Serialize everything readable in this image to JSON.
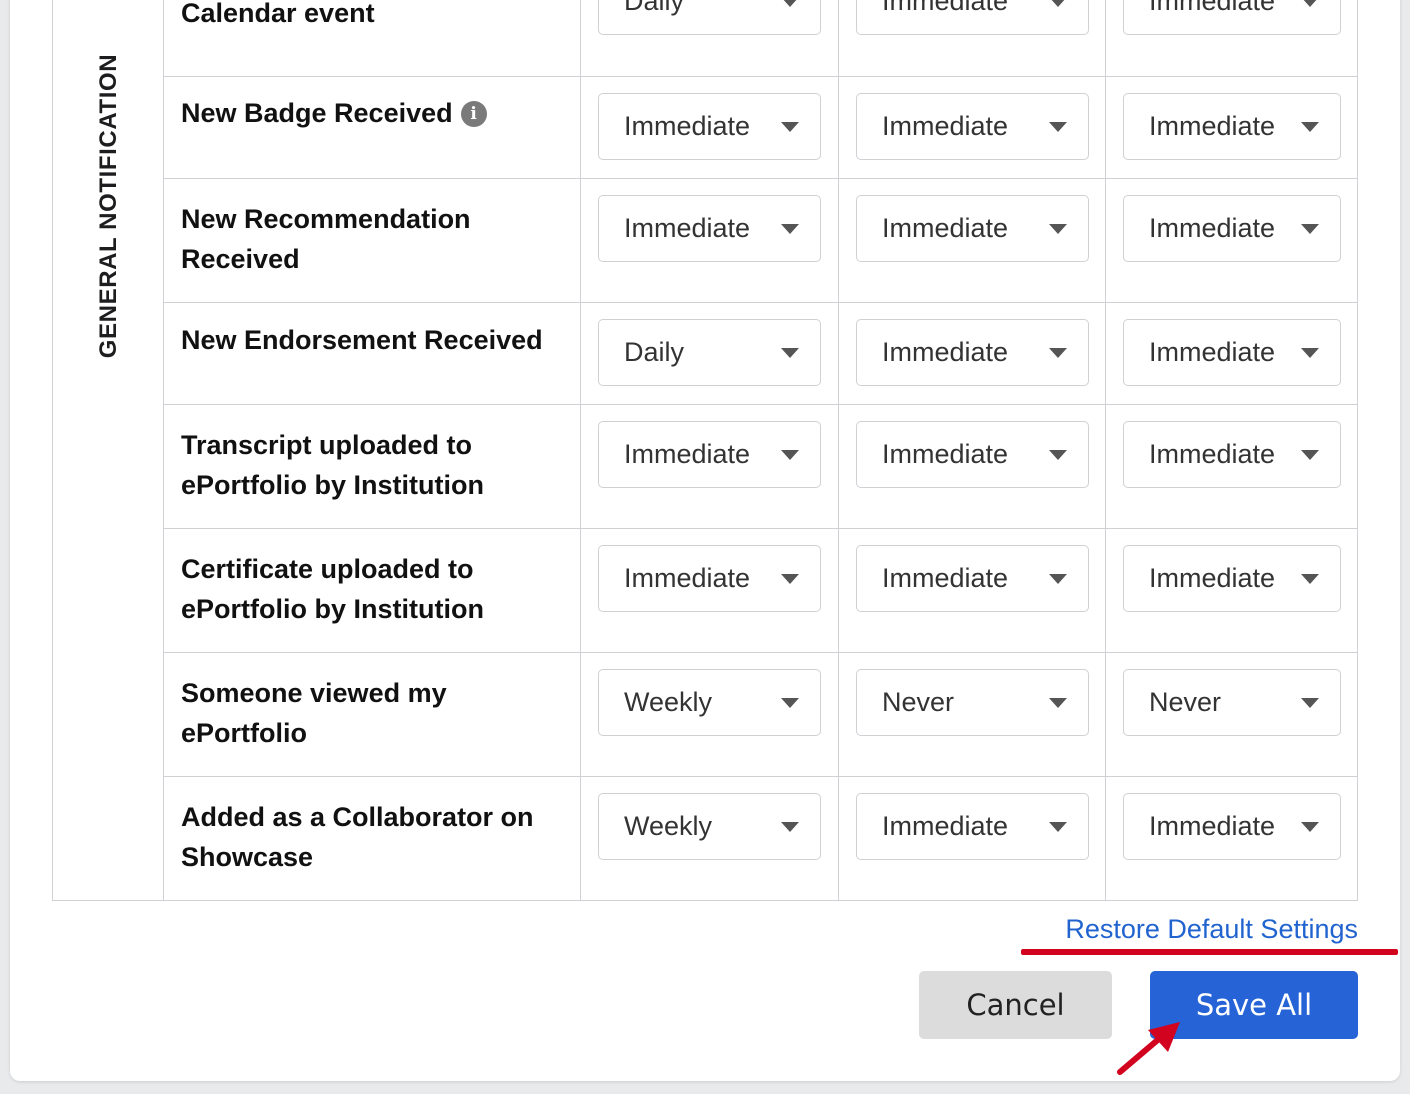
{
  "section": {
    "title": "GENERAL NOTIFICATION"
  },
  "rows": [
    {
      "name": "Calendar event",
      "v1": "Daily",
      "v2": "Immediate",
      "v3": "Immediate"
    },
    {
      "name": "New Badge Received",
      "v1": "Immediate",
      "v2": "Immediate",
      "v3": "Immediate"
    },
    {
      "name": "New Recommendation Received",
      "v1": "Immediate",
      "v2": "Immediate",
      "v3": "Immediate"
    },
    {
      "name": "New Endorsement Received",
      "v1": "Daily",
      "v2": "Immediate",
      "v3": "Immediate"
    },
    {
      "name": "Transcript uploaded to ePortfolio by Institution",
      "v1": "Immediate",
      "v2": "Immediate",
      "v3": "Immediate"
    },
    {
      "name": "Certificate uploaded to ePortfolio by Institution",
      "v1": "Immediate",
      "v2": "Immediate",
      "v3": "Immediate"
    },
    {
      "name": "Someone viewed my ePortfolio",
      "v1": "Weekly",
      "v2": "Never",
      "v3": "Never"
    },
    {
      "name": "Added as a Collaborator on Showcase",
      "v1": "Weekly",
      "v2": "Immediate",
      "v3": "Immediate"
    }
  ],
  "icons": {
    "info": "info-icon",
    "caret": "chevron-down-icon",
    "annotation": "red-arrow-icon"
  },
  "info_glyph": "i",
  "actions": {
    "restore_label": "Restore Default Settings",
    "cancel_label": "Cancel",
    "save_label": "Save All"
  },
  "colors": {
    "accent": "#2563d6",
    "link": "#2164d0",
    "annotation_red": "#d1031f",
    "cancel_bg": "#dcdcdc"
  }
}
